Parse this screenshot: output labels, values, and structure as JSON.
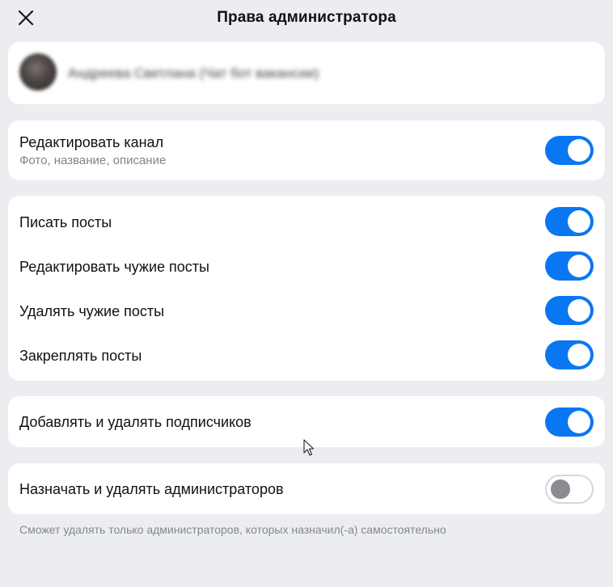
{
  "header": {
    "title": "Права администратора"
  },
  "user": {
    "name": "Андреева Светлана (Чат бот вакансии)"
  },
  "sections": {
    "edit_channel": {
      "label": "Редактировать канал",
      "sublabel": "Фото, название, описание",
      "enabled": true
    },
    "posts": [
      {
        "label": "Писать посты",
        "enabled": true
      },
      {
        "label": "Редактировать чужие посты",
        "enabled": true
      },
      {
        "label": "Удалять чужие посты",
        "enabled": true
      },
      {
        "label": "Закреплять посты",
        "enabled": true
      }
    ],
    "subscribers": {
      "label": "Добавлять и удалять подписчиков",
      "enabled": true
    },
    "admins": {
      "label": "Назначать и удалять администраторов",
      "enabled": false
    }
  },
  "footnote": "Сможет удалять только администраторов, которых назначил(-а) самостоятельно",
  "colors": {
    "background": "#ebedf0",
    "toggle_on": "#0a77f2",
    "toggle_off_knob": "#8a8c90"
  }
}
